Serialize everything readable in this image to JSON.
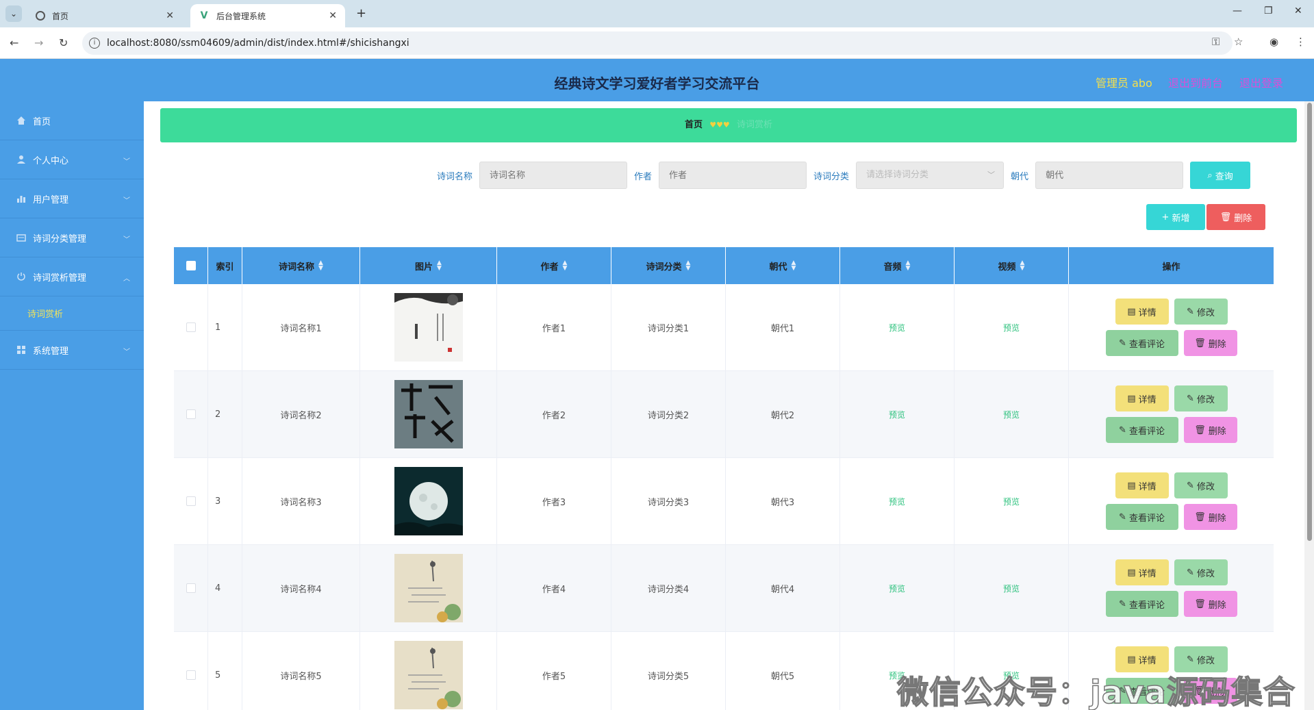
{
  "browser": {
    "tabs": [
      {
        "title": "首页",
        "active": false
      },
      {
        "title": "后台管理系统",
        "active": true
      }
    ],
    "url": "localhost:8080/ssm04609/admin/dist/index.html#/shicishangxi"
  },
  "header": {
    "title": "经典诗文学习爱好者学习交流平台",
    "admin": "管理员 abo",
    "to_front": "退出到前台",
    "logout": "退出登录"
  },
  "sidebar": {
    "items": [
      {
        "label": "首页",
        "icon": "home-icon"
      },
      {
        "label": "个人中心",
        "icon": "user-icon"
      },
      {
        "label": "用户管理",
        "icon": "chart-icon"
      },
      {
        "label": "诗词分类管理",
        "icon": "card-icon"
      },
      {
        "label": "诗词赏析管理",
        "icon": "power-icon"
      },
      {
        "label": "系统管理",
        "icon": "grid-icon"
      }
    ],
    "submenu": "诗词赏析"
  },
  "breadcrumb": {
    "home": "首页",
    "current": "诗词赏析"
  },
  "search": {
    "name_label": "诗词名称",
    "name_placeholder": "诗词名称",
    "author_label": "作者",
    "author_placeholder": "作者",
    "category_label": "诗词分类",
    "category_placeholder": "请选择诗词分类",
    "dynasty_label": "朝代",
    "dynasty_placeholder": "朝代",
    "query_btn": "查询"
  },
  "actions": {
    "add": "新增",
    "delete": "删除"
  },
  "table": {
    "headers": {
      "index": "索引",
      "name": "诗词名称",
      "image": "图片",
      "author": "作者",
      "category": "诗词分类",
      "dynasty": "朝代",
      "audio": "音频",
      "video": "视频",
      "ops": "操作"
    },
    "preview": "预览",
    "ops": {
      "detail": "详情",
      "edit": "修改",
      "comment": "查看评论",
      "remove": "删除"
    },
    "rows": [
      {
        "index": "1",
        "name": "诗词名称1",
        "author": "作者1",
        "category": "诗词分类1",
        "dynasty": "朝代1"
      },
      {
        "index": "2",
        "name": "诗词名称2",
        "author": "作者2",
        "category": "诗词分类2",
        "dynasty": "朝代2"
      },
      {
        "index": "3",
        "name": "诗词名称3",
        "author": "作者3",
        "category": "诗词分类3",
        "dynasty": "朝代3"
      },
      {
        "index": "4",
        "name": "诗词名称4",
        "author": "作者4",
        "category": "诗词分类4",
        "dynasty": "朝代4"
      },
      {
        "index": "5",
        "name": "诗词名称5",
        "author": "作者5",
        "category": "诗词分类5",
        "dynasty": "朝代5"
      }
    ]
  },
  "watermark": "微信公众号：java源码集合",
  "colors": {
    "header": "#4a9ee6",
    "breadcrumb": "#3ddb9a",
    "query": "#36d6d6",
    "danger": "#ee5e5e"
  }
}
